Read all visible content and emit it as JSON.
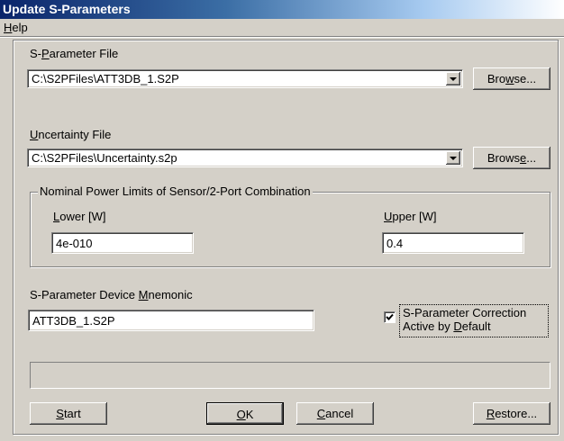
{
  "window": {
    "title": "Update S-Parameters"
  },
  "menu": {
    "help": {
      "pre": "",
      "key": "H",
      "post": "elp"
    }
  },
  "sparam_file": {
    "label": {
      "pre": "S-",
      "key": "P",
      "post": "arameter File"
    },
    "value": "C:\\S2PFiles\\ATT3DB_1.S2P",
    "browse": {
      "pre": "Bro",
      "key": "w",
      "post": "se..."
    }
  },
  "uncertainty_file": {
    "label": {
      "pre": "",
      "key": "U",
      "post": "ncertainty File"
    },
    "value": "C:\\S2PFiles\\Uncertainty.s2p",
    "browse": {
      "pre": "Brows",
      "key": "e",
      "post": "..."
    }
  },
  "limits": {
    "caption": "Nominal Power Limits of Sensor/2-Port Combination",
    "lower_label": {
      "pre": "",
      "key": "L",
      "post": "ower [W]"
    },
    "lower_value": "4e-010",
    "upper_label": {
      "pre": "",
      "key": "U",
      "post": "pper [W]"
    },
    "upper_value": "0.4"
  },
  "mnemonic": {
    "label": {
      "pre": "S-Parameter Device ",
      "key": "M",
      "post": "nemonic"
    },
    "value": "ATT3DB_1.S2P"
  },
  "correction": {
    "checked": true,
    "line1": "S-Parameter Correction",
    "line2": {
      "pre": "Active by ",
      "key": "D",
      "post": "efault"
    }
  },
  "buttons": {
    "start": {
      "pre": "",
      "key": "S",
      "post": "tart"
    },
    "ok": {
      "pre": "",
      "key": "O",
      "post": "K"
    },
    "cancel": {
      "pre": "",
      "key": "C",
      "post": "ancel"
    },
    "restore": {
      "pre": "",
      "key": "R",
      "post": "estore..."
    }
  }
}
